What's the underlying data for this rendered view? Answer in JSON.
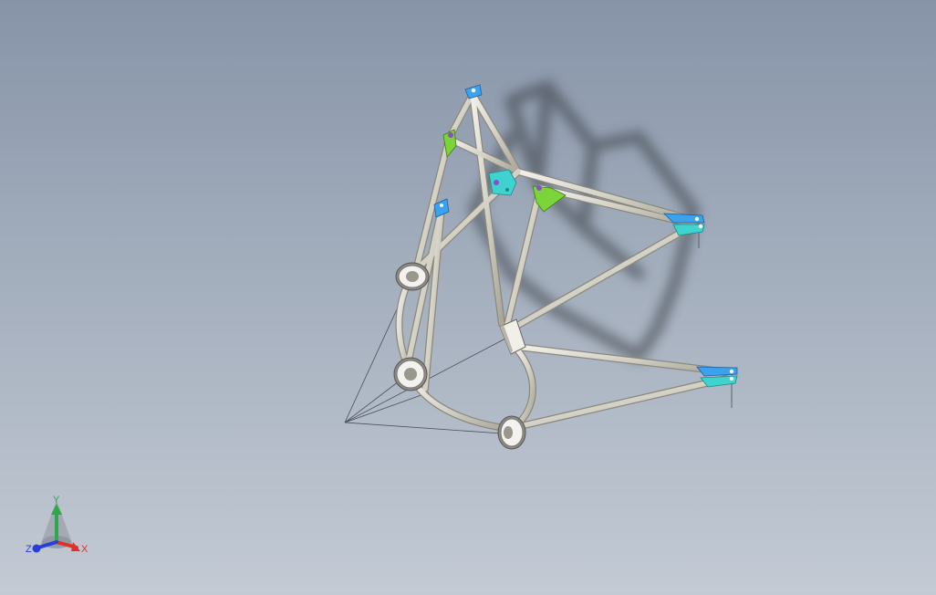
{
  "viewport": {
    "background_top": "#8794a8",
    "background_bottom": "#c3cad4",
    "model": "tubular-frame-assembly"
  },
  "colors": {
    "tube": "#d8d5cc",
    "tube_shadow": "#a9a699",
    "bracket_blue": "#3aa2ee",
    "bracket_cyan": "#3fd2cf",
    "gusset_green": "#7ad43a",
    "bolt_purple": "#8a4fc8",
    "construction_line": "#4a4f58"
  },
  "triad": {
    "x_label": "X",
    "y_label": "Y",
    "z_label": "Z",
    "x_color": "#e0302a",
    "y_color": "#2fa84a",
    "z_color": "#2a3fd8",
    "icon": "coordinate-triad-icon"
  }
}
